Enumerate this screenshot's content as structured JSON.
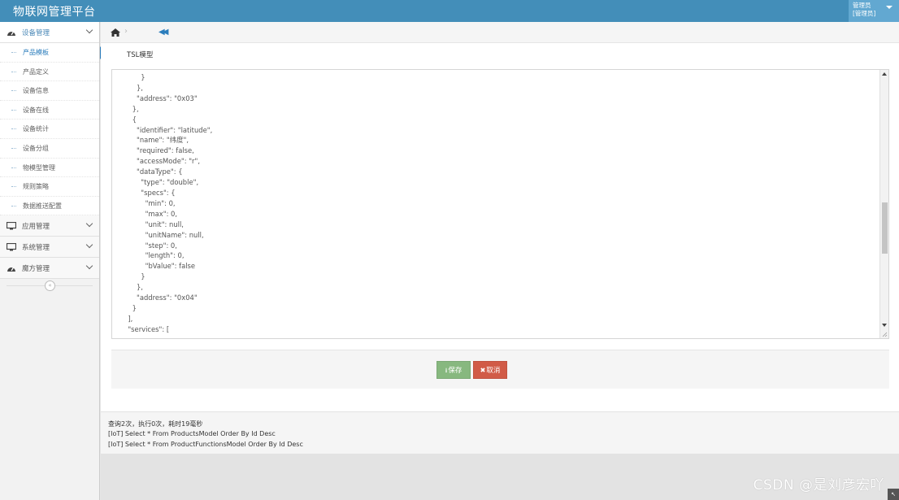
{
  "app": {
    "title": "物联网管理平台"
  },
  "user": {
    "line1": "管理员",
    "line2": "[管理员]"
  },
  "sidebar": {
    "groups": [
      {
        "label": "设备管理",
        "icon": "dashboard-icon"
      },
      {
        "label": "应用管理",
        "icon": "monitor-icon"
      },
      {
        "label": "系统管理",
        "icon": "monitor-icon"
      },
      {
        "label": "魔方管理",
        "icon": "dashboard-icon"
      }
    ],
    "items": [
      {
        "label": "产品模板"
      },
      {
        "label": "产品定义"
      },
      {
        "label": "设备信息"
      },
      {
        "label": "设备在线"
      },
      {
        "label": "设备统计"
      },
      {
        "label": "设备分组"
      },
      {
        "label": "物模型管理"
      },
      {
        "label": "规则策略"
      },
      {
        "label": "数据推送配置"
      }
    ],
    "collapse_glyph": "«"
  },
  "breadcrumb": {
    "separator": "›",
    "back_glyph": "◀◀"
  },
  "form": {
    "section_title": "TSL模型",
    "tsl_text": "        }\n      },\n      \"address\": \"0x03\"\n    },\n    {\n      \"identifier\": \"latitude\",\n      \"name\": \"纬度\",\n      \"required\": false,\n      \"accessMode\": \"r\",\n      \"dataType\": {\n        \"type\": \"double\",\n        \"specs\": {\n          \"min\": 0,\n          \"max\": 0,\n          \"unit\": null,\n          \"unitName\": null,\n          \"step\": 0,\n          \"length\": 0,\n          \"bValue\": false\n        }\n      },\n      \"address\": \"0x04\"\n    }\n  ],\n  \"services\": [",
    "save_label": "保存",
    "cancel_label": "取消",
    "save_glyph": "⭳",
    "cancel_glyph": "✖"
  },
  "log": {
    "summary": "查询2次，执行0次，耗时19毫秒",
    "lines": [
      "[IoT] Select * From ProductsModel Order By Id Desc",
      "[IoT] Select * From ProductFunctionsModel Order By Id Desc"
    ]
  },
  "watermark": "CSDN @是刘彦宏吖"
}
